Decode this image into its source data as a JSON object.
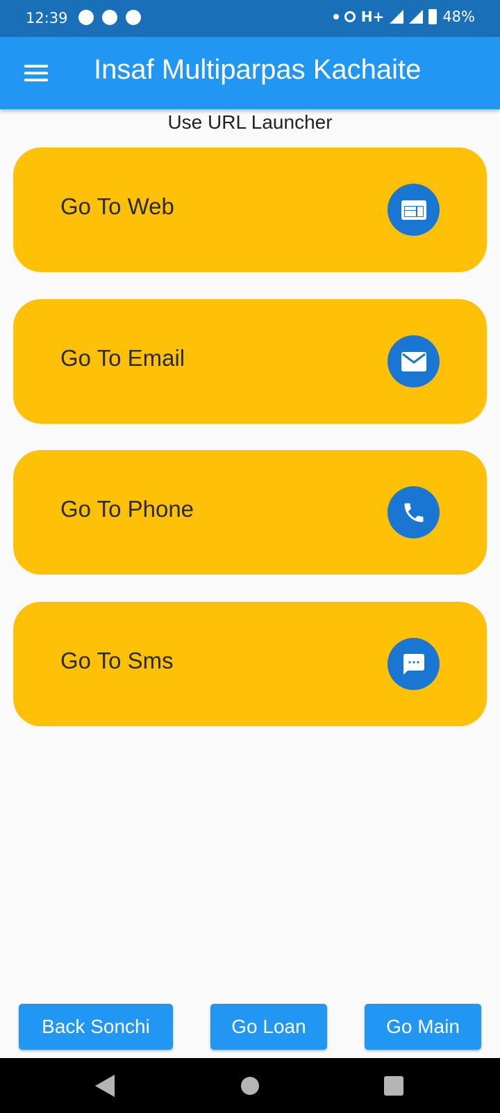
{
  "status_bar": {
    "time": "12:39",
    "network": "H+",
    "battery": "48%",
    "icons": [
      "notification-icon",
      "messenger-icon",
      "notification-icon",
      "dot-icon",
      "hotspot-icon",
      "signal-icon",
      "signal-icon",
      "battery-icon"
    ]
  },
  "app_bar": {
    "title": "Insaf Multiparpas Kachaite",
    "menu_icon": "menu-icon"
  },
  "subtitle": "Use URL Launcher",
  "cards": [
    {
      "label": "Go To Web",
      "icon": "web-icon"
    },
    {
      "label": "Go To Email",
      "icon": "email-icon"
    },
    {
      "label": "Go To Phone",
      "icon": "phone-icon"
    },
    {
      "label": "Go To Sms",
      "icon": "sms-icon"
    }
  ],
  "buttons": {
    "back": "Back Sonchi",
    "loan": "Go Loan",
    "main": "Go Main"
  },
  "colors": {
    "status_bar": "#1a6fb9",
    "app_bar": "#2196f3",
    "card": "#ffc107",
    "icon_circle": "#1976d2",
    "button": "#2196f3"
  }
}
